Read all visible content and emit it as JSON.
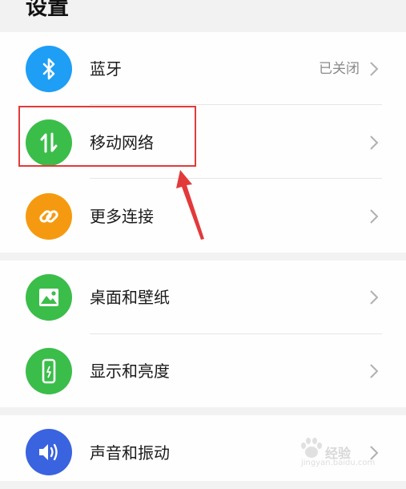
{
  "header": {
    "title": "设置"
  },
  "groups": [
    {
      "items": [
        {
          "label": "蓝牙",
          "value": "已关闭",
          "icon": "bluetooth-icon",
          "color": "#1e9ef5"
        },
        {
          "label": "移动网络",
          "icon": "mobile-data-arrows-icon",
          "color": "#3bbd4a"
        },
        {
          "label": "更多连接",
          "icon": "link-icon",
          "color": "#f59a10"
        }
      ]
    },
    {
      "items": [
        {
          "label": "桌面和壁纸",
          "icon": "image-icon",
          "color": "#3bbd4a"
        },
        {
          "label": "显示和亮度",
          "icon": "phone-brightness-icon",
          "color": "#3bbd4a"
        }
      ]
    },
    {
      "items": [
        {
          "label": "声音和振动",
          "icon": "speaker-icon",
          "color": "#3a63e0"
        }
      ]
    }
  ],
  "annotation": {
    "highlight_color": "#e23a3a"
  },
  "watermark": {
    "line1": "经验",
    "line2": "jingyan.baidu.com"
  }
}
